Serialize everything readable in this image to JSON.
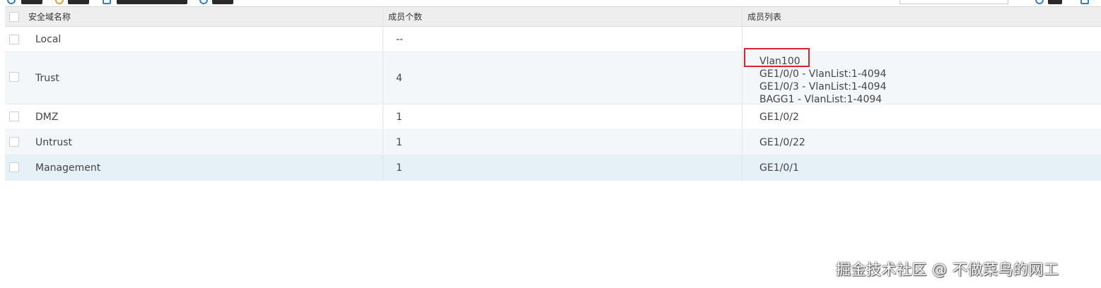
{
  "toolbar": {
    "search_placeholder": ""
  },
  "table": {
    "headers": {
      "name": "安全域名称",
      "count": "成员个数",
      "members": "成员列表"
    },
    "rows": [
      {
        "name": "Local",
        "count": "--",
        "members": []
      },
      {
        "name": "Trust",
        "count": "4",
        "members": [
          "Vlan100",
          "GE1/0/0 - VlanList:1-4094",
          "GE1/0/3 - VlanList:1-4094",
          "BAGG1 - VlanList:1-4094"
        ]
      },
      {
        "name": "DMZ",
        "count": "1",
        "members": [
          "GE1/0/2"
        ]
      },
      {
        "name": "Untrust",
        "count": "1",
        "members": [
          "GE1/0/22"
        ]
      },
      {
        "name": "Management",
        "count": "1",
        "members": [
          "GE1/0/1"
        ]
      }
    ]
  },
  "annotation": {
    "highlight_color": "#d9262e"
  },
  "watermark": "掘金技术社区 @ 不做菜鸟的网工"
}
